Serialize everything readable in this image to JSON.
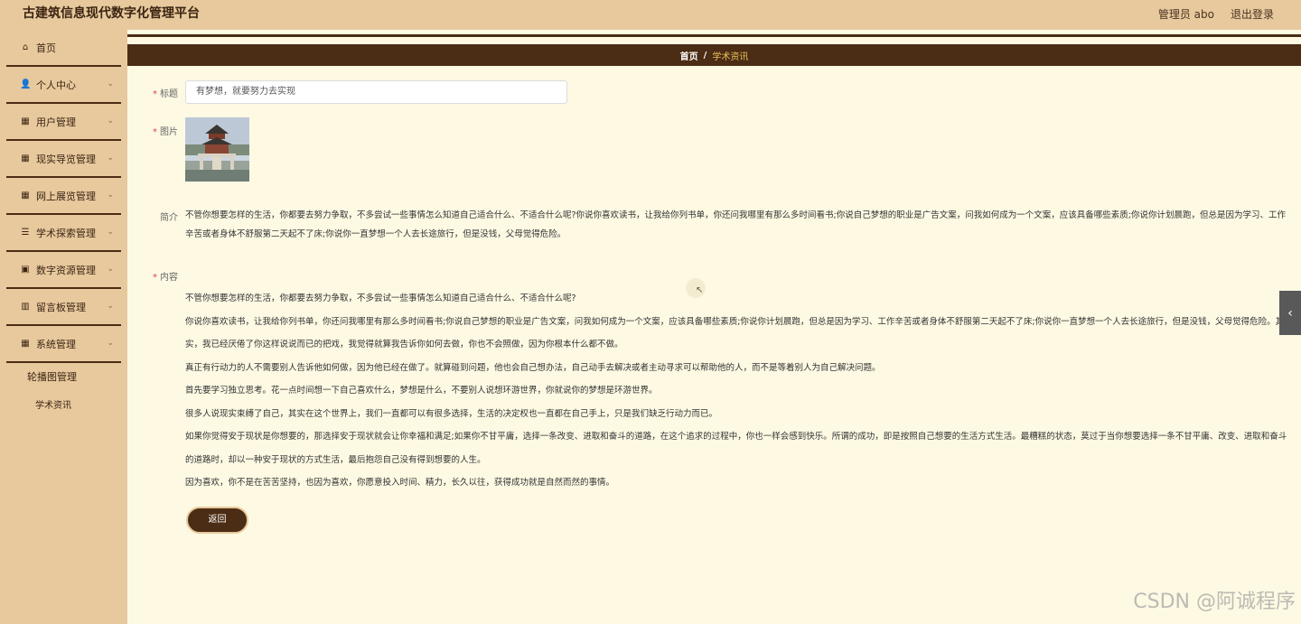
{
  "header": {
    "title": "古建筑信息现代数字化管理平台",
    "user": "管理员 abo",
    "logout": "退出登录"
  },
  "sidebar": {
    "items": [
      {
        "label": "首页",
        "icon": "home-icon",
        "glyph": "⌂",
        "expandable": false
      },
      {
        "label": "个人中心",
        "icon": "user-icon",
        "glyph": "👤",
        "expandable": true
      },
      {
        "label": "用户管理",
        "icon": "grid-icon",
        "glyph": "▦",
        "expandable": true
      },
      {
        "label": "现实导览管理",
        "icon": "grid-icon",
        "glyph": "▦",
        "expandable": true
      },
      {
        "label": "网上展览管理",
        "icon": "grid-icon",
        "glyph": "▦",
        "expandable": true
      },
      {
        "label": "学术探索管理",
        "icon": "sliders-icon",
        "glyph": "☰",
        "expandable": true
      },
      {
        "label": "数字资源管理",
        "icon": "clipboard-icon",
        "glyph": "▣",
        "expandable": true
      },
      {
        "label": "留言板管理",
        "icon": "bar-chart-icon",
        "glyph": "▥",
        "expandable": true
      },
      {
        "label": "系统管理",
        "icon": "grid-icon",
        "glyph": "▦",
        "expandable": true
      }
    ],
    "submenu": {
      "carousel": "轮播图管理",
      "news": "学术资讯"
    }
  },
  "breadcrumb": {
    "home": "首页",
    "sep": "/",
    "current": "学术资讯"
  },
  "form": {
    "title_label": "标题",
    "title_value": "有梦想，就要努力去实现",
    "image_label": "图片",
    "intro_label": "简介",
    "intro_text": "不管你想要怎样的生活，你都要去努力争取，不多尝试一些事情怎么知道自己适合什么、不适合什么呢?你说你喜欢读书，让我给你列书单，你还问我哪里有那么多时间看书;你说自己梦想的职业是广告文案，问我如何成为一个文案，应该具备哪些素质;你说你计划晨跑，但总是因为学习、工作辛苦或者身体不舒服第二天起不了床;你说你一直梦想一个人去长途旅行，但是没钱，父母觉得危险。",
    "content_label": "内容",
    "content_paragraphs": [
      "不管你想要怎样的生活，你都要去努力争取，不多尝试一些事情怎么知道自己适合什么、不适合什么呢?",
      "你说你喜欢读书，让我给你列书单，你还问我哪里有那么多时间看书;你说自己梦想的职业是广告文案，问我如何成为一个文案，应该具备哪些素质;你说你计划晨跑，但总是因为学习、工作辛苦或者身体不舒服第二天起不了床;你说你一直梦想一个人去长途旅行，但是没钱，父母觉得危险。其实，我已经厌倦了你这样说说而已的把戏，我觉得就算我告诉你如何去做，你也不会照做，因为你根本什么都不做。",
      "真正有行动力的人不需要别人告诉他如何做，因为他已经在做了。就算碰到问题，他也会自己想办法，自己动手去解决或者主动寻求可以帮助他的人，而不是等着别人为自己解决问题。",
      "首先要学习独立思考。花一点时间想一下自己喜欢什么，梦想是什么，不要别人说想环游世界，你就说你的梦想是环游世界。",
      "很多人说现实束缚了自己，其实在这个世界上，我们一直都可以有很多选择，生活的决定权也一直都在自己手上，只是我们缺乏行动力而已。",
      "如果你觉得安于现状是你想要的，那选择安于现状就会让你幸福和满足;如果你不甘平庸，选择一条改变、进取和奋斗的道路，在这个追求的过程中，你也一样会感到快乐。所谓的成功，即是按照自己想要的生活方式生活。最糟糕的状态，莫过于当你想要选择一条不甘平庸、改变、进取和奋斗的道路时，却以一种安于现状的方式生活，最后抱怨自己没有得到想要的人生。",
      "因为喜欢，你不是在苦苦坚持，也因为喜欢，你愿意投入时间、精力，长久以往，获得成功就是自然而然的事情。"
    ],
    "back_label": "返回",
    "required_mark": "*"
  },
  "watermark": "CSDN @阿诚程序",
  "colors": {
    "accent_dark": "#4b2c14",
    "sidebar_bg": "#e7c99d",
    "page_bg": "#fdf9e3",
    "breadcrumb_current": "#e7c05a"
  }
}
